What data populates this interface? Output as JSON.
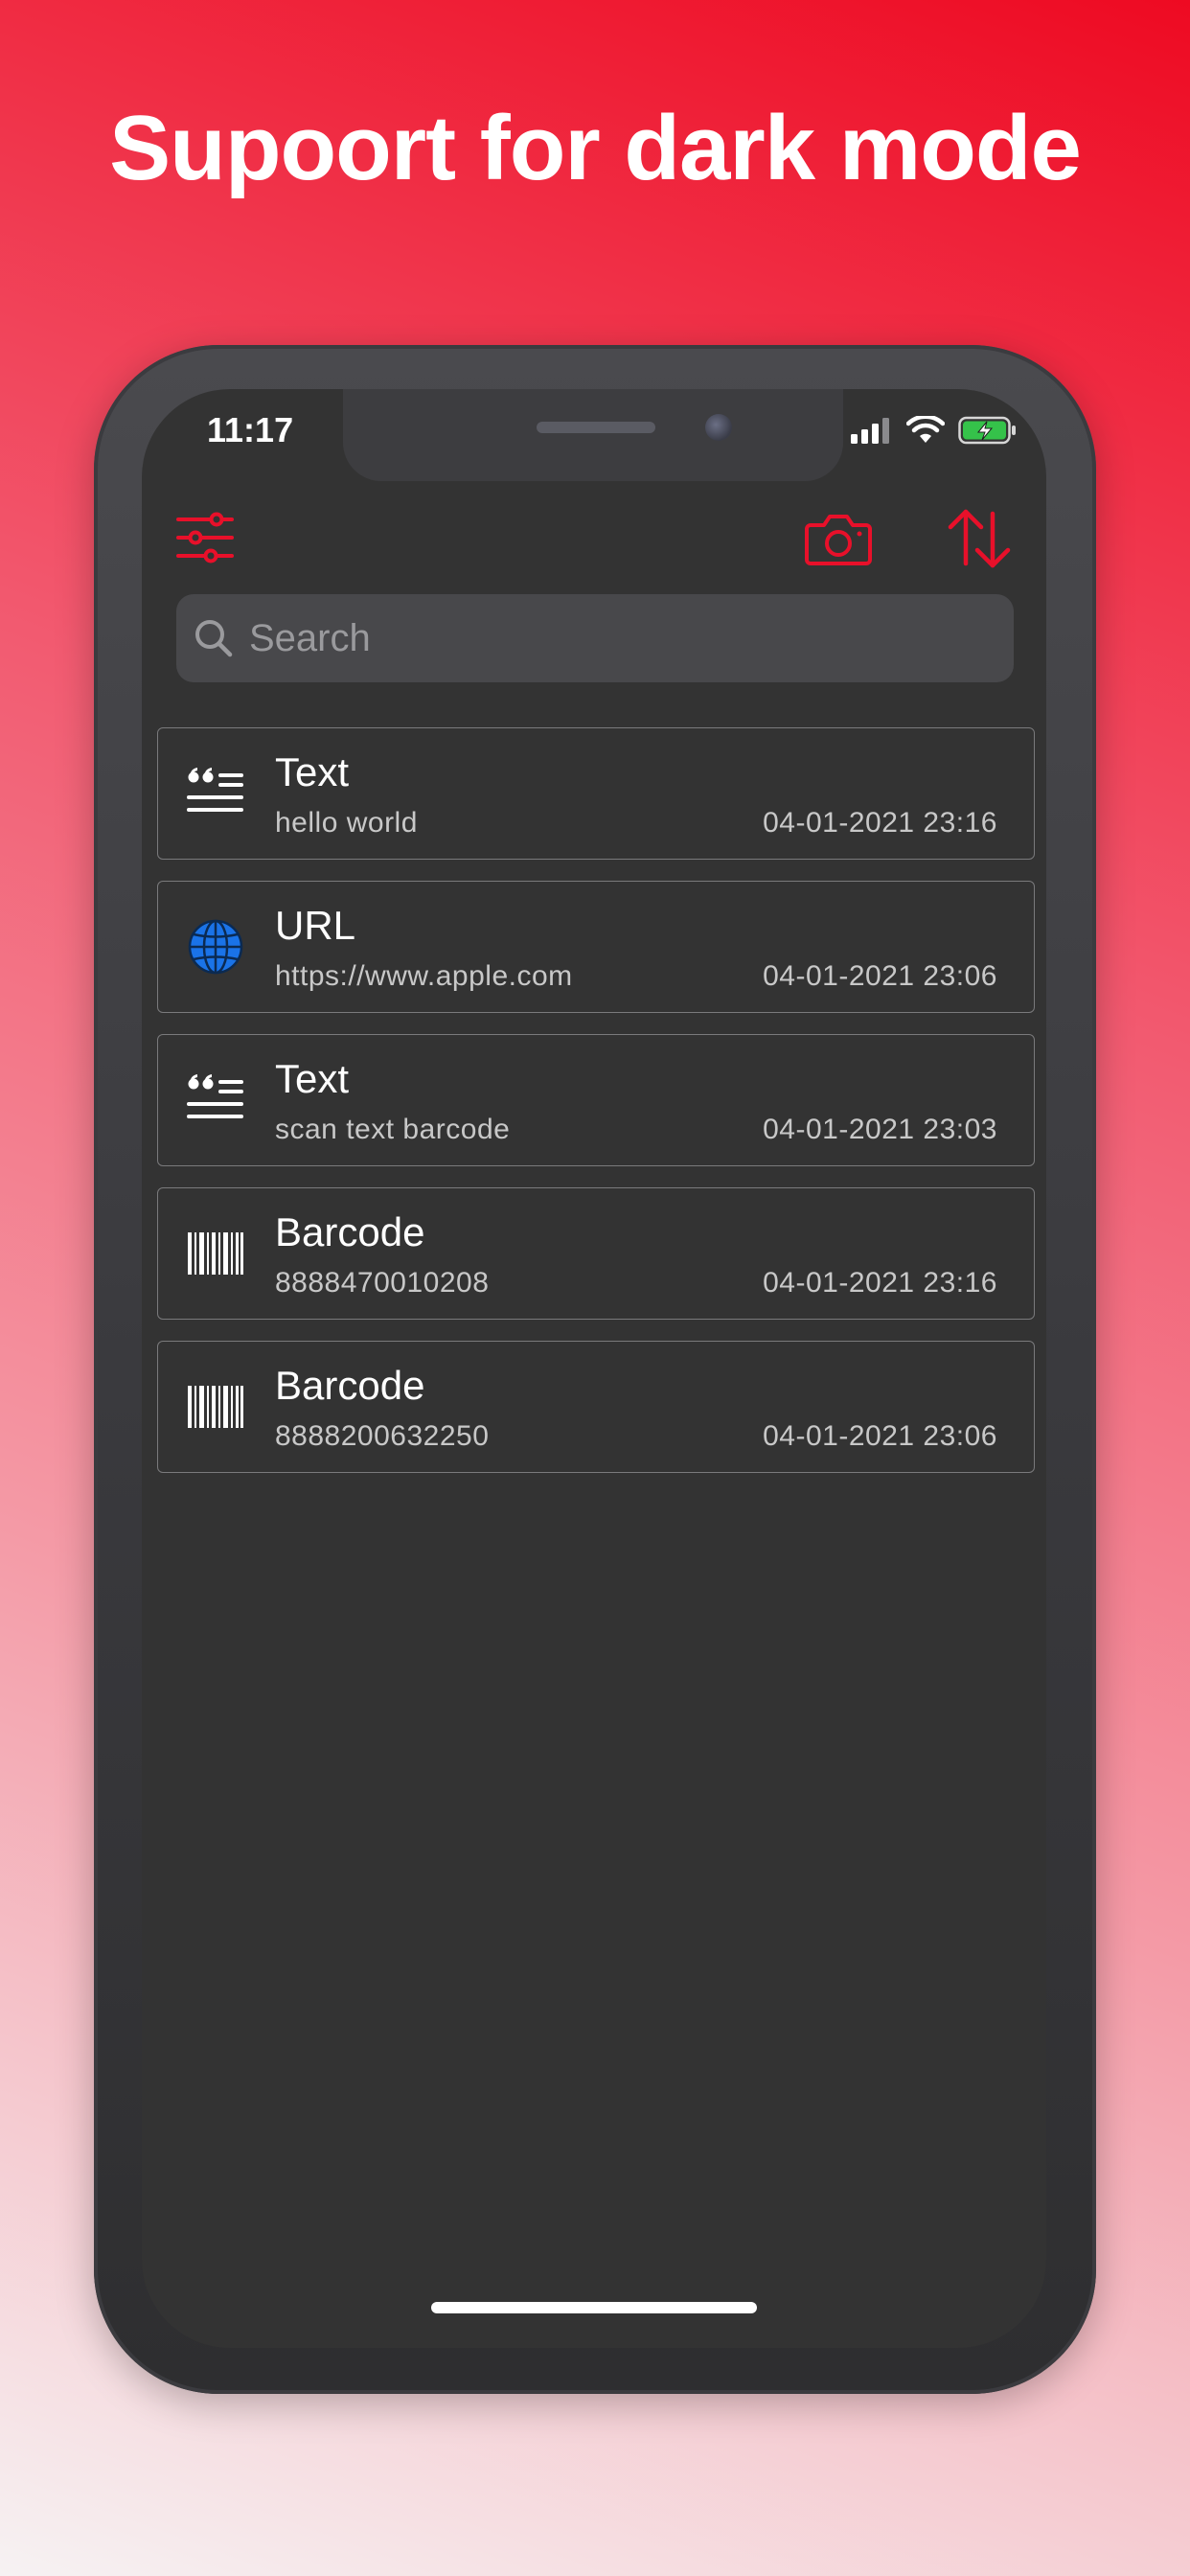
{
  "headline": "Supoort for dark mode",
  "status_bar": {
    "time": "11:17"
  },
  "search": {
    "placeholder": "Search",
    "value": ""
  },
  "colors": {
    "accent": "#e8102a",
    "background": "#333333",
    "card_border": "#7a7a7c",
    "url_icon": "#1a73e8"
  },
  "history": [
    {
      "icon": "text-quote-icon",
      "title": "Text",
      "content": "hello world",
      "date": "04-01-2021 23:16"
    },
    {
      "icon": "globe-icon",
      "title": "URL",
      "content": "https://www.apple.com",
      "date": "04-01-2021 23:06"
    },
    {
      "icon": "text-quote-icon",
      "title": "Text",
      "content": "scan text barcode",
      "date": "04-01-2021 23:03"
    },
    {
      "icon": "barcode-icon",
      "title": "Barcode",
      "content": "8888470010208",
      "date": "04-01-2021 23:16"
    },
    {
      "icon": "barcode-icon",
      "title": "Barcode",
      "content": "8888200632250",
      "date": "04-01-2021 23:06"
    }
  ]
}
